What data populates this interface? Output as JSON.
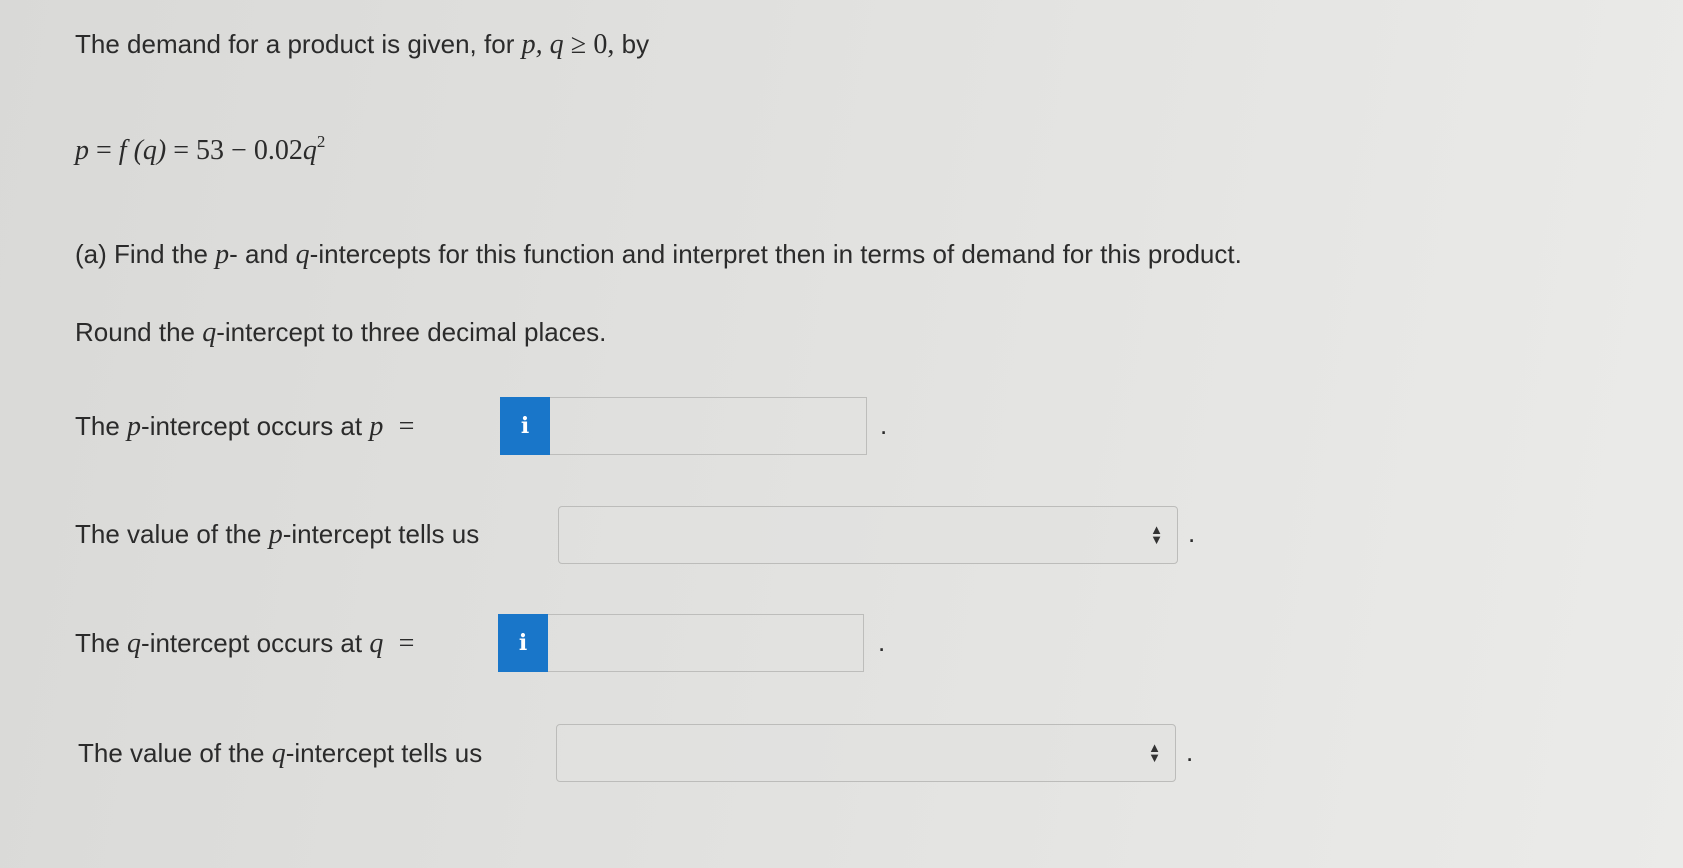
{
  "intro": {
    "text_before": "The demand for a product is given, for ",
    "vars": "p, q",
    "geq": "≥",
    "zero": "0,",
    "text_after": " by"
  },
  "equation": {
    "p": "p",
    "eq1": " = ",
    "f": "f",
    "arg": " (q) ",
    "eq2": "= 53 − 0.02",
    "q": "q",
    "exp": "2"
  },
  "part_a": {
    "prefix": "(a) Find the ",
    "p": "p",
    "mid1": "- and ",
    "q": "q",
    "rest": "-intercepts for this function and interpret then in terms of demand for this product."
  },
  "round_note": {
    "before": "Round the ",
    "q": "q",
    "after": "-intercept to three decimal places."
  },
  "p_intercept": {
    "label_before": "The ",
    "p": "p",
    "label_after": "-intercept occurs at ",
    "var": "p",
    "equals": "=",
    "info": "i",
    "value": "",
    "period": "."
  },
  "p_interpret": {
    "label_before": "The value of the ",
    "p": "p",
    "label_after": "-intercept tells us",
    "selected": "",
    "period": "."
  },
  "q_intercept": {
    "label_before": "The ",
    "q": "q",
    "label_after": "-intercept occurs at ",
    "var": "q",
    "equals": "=",
    "info": "i",
    "value": "",
    "period": "."
  },
  "q_interpret": {
    "label_before": "The value of the ",
    "q": "q",
    "label_after": "-intercept tells us",
    "selected": "",
    "period": "."
  },
  "colors": {
    "info_button": "#1976c9",
    "text": "#2b2b2b"
  },
  "icons": {
    "info": "info-icon",
    "select": "updown-chevron-icon"
  }
}
